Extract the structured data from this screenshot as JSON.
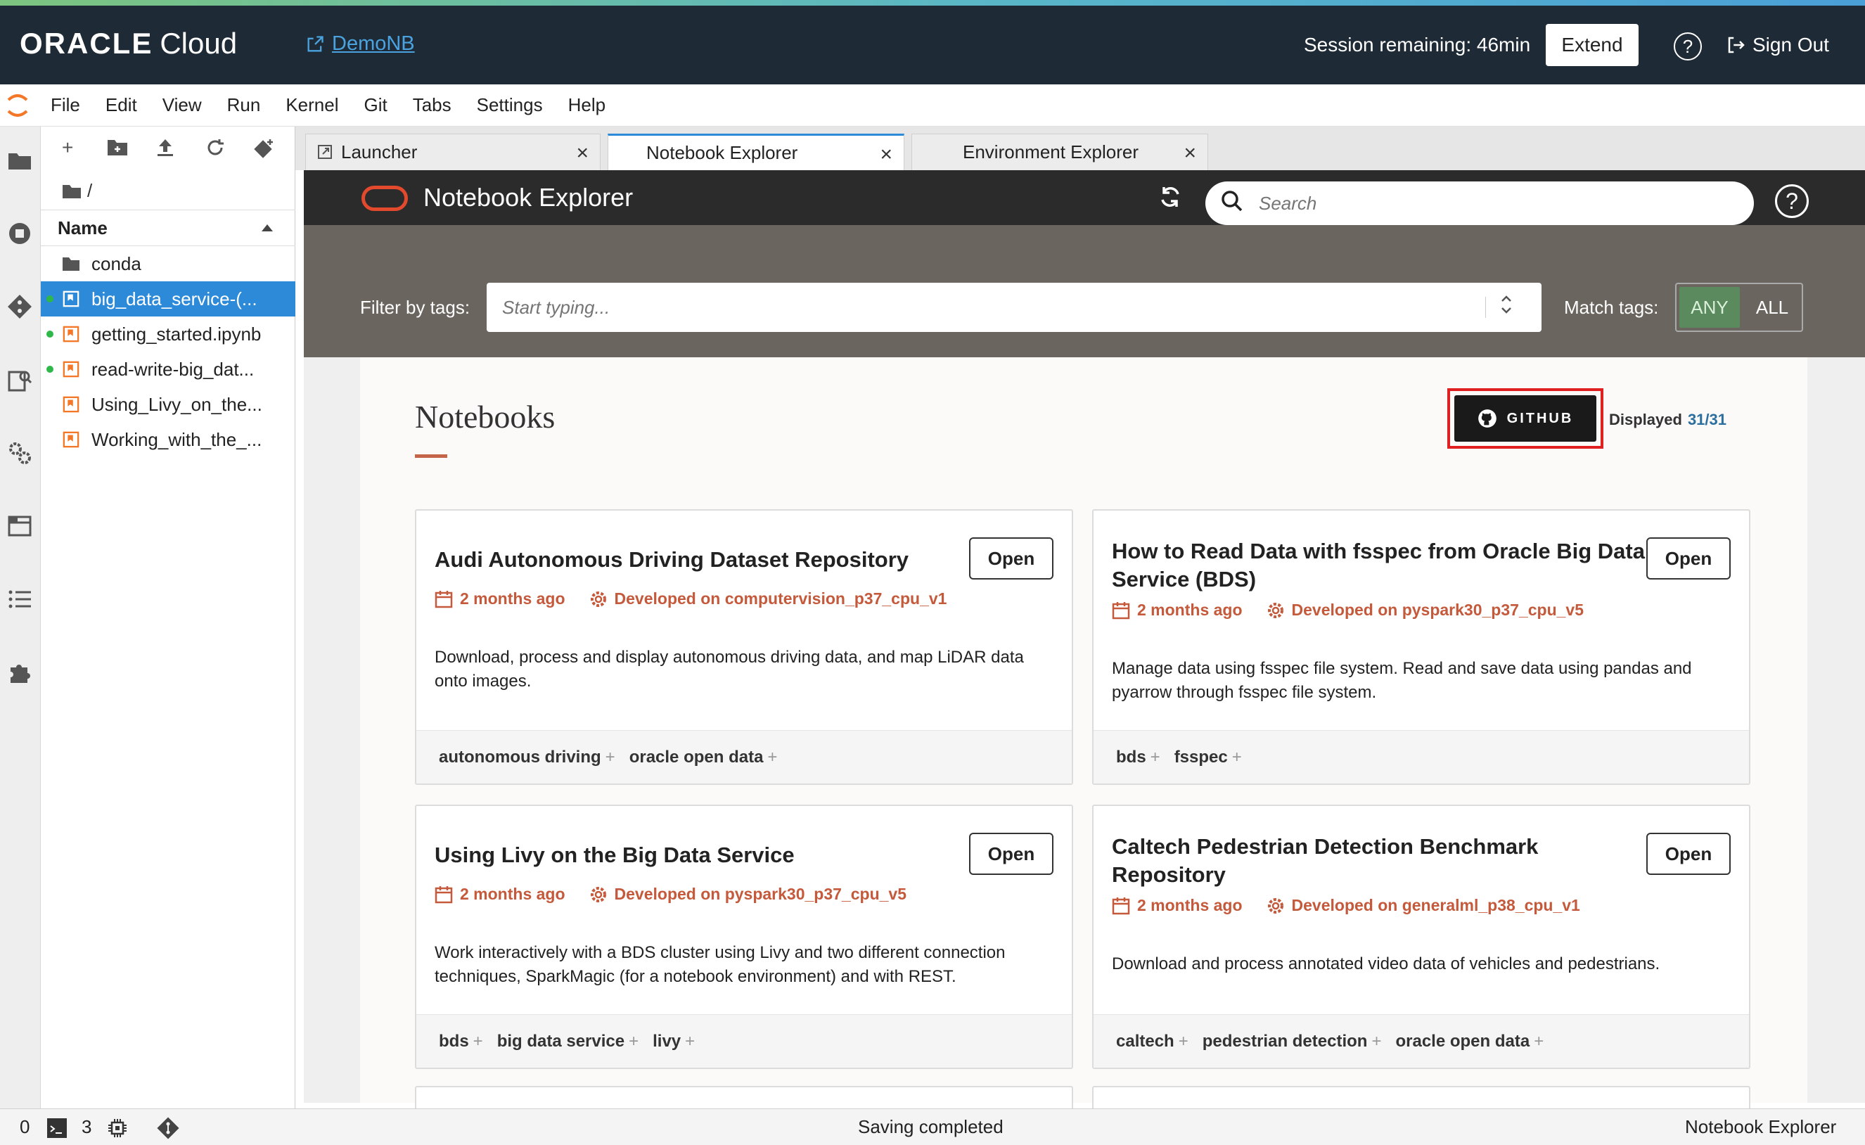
{
  "header": {
    "logo_main": "ORACLE",
    "logo_sub": "Cloud",
    "project_link": "DemoNB",
    "session": "Session remaining: 46min",
    "extend_label": "Extend",
    "help_glyph": "?",
    "signout_label": "Sign Out"
  },
  "menu": [
    "File",
    "Edit",
    "View",
    "Run",
    "Kernel",
    "Git",
    "Tabs",
    "Settings",
    "Help"
  ],
  "file_browser": {
    "path": "/",
    "column_name": "Name",
    "items": [
      {
        "name": "conda",
        "type": "folder",
        "running": false,
        "selected": false
      },
      {
        "name": "big_data_service-(...",
        "type": "notebook",
        "running": true,
        "selected": true
      },
      {
        "name": "getting_started.ipynb",
        "type": "notebook",
        "running": true,
        "selected": false
      },
      {
        "name": "read-write-big_dat...",
        "type": "notebook",
        "running": true,
        "selected": false
      },
      {
        "name": "Using_Livy_on_the...",
        "type": "notebook",
        "running": false,
        "selected": false
      },
      {
        "name": "Working_with_the_...",
        "type": "notebook",
        "running": false,
        "selected": false
      }
    ]
  },
  "tabs": [
    {
      "label": "Launcher",
      "active": false
    },
    {
      "label": "Notebook Explorer",
      "active": true
    },
    {
      "label": "Environment Explorer",
      "active": false
    }
  ],
  "explorer": {
    "title": "Notebook Explorer",
    "search_placeholder": "Search",
    "filter_label": "Filter by tags:",
    "filter_placeholder": "Start typing...",
    "match_label": "Match tags:",
    "match_any": "ANY",
    "match_all": "ALL",
    "section_title": "Notebooks",
    "github_label": "GITHUB",
    "displayed_label": "Displayed",
    "displayed_count": "31/31"
  },
  "cards": [
    {
      "title": "Audi Autonomous Driving Dataset Repository",
      "open": "Open",
      "date": "2 months ago",
      "env": "Developed on computervision_p37_cpu_v1",
      "description": "Download, process and display autonomous driving data, and map LiDAR data onto images.",
      "tags": [
        "autonomous driving",
        "oracle open data"
      ]
    },
    {
      "title": "How to Read Data with fsspec from Oracle Big Data Service (BDS)",
      "open": "Open",
      "date": "2 months ago",
      "env": "Developed on pyspark30_p37_cpu_v5",
      "description": "Manage data using fsspec file system. Read and save data using pandas and pyarrow through fsspec file system.",
      "tags": [
        "bds",
        "fsspec"
      ]
    },
    {
      "title": "Using Livy on the Big Data Service",
      "open": "Open",
      "date": "2 months ago",
      "env": "Developed on pyspark30_p37_cpu_v5",
      "description": "Work interactively with a BDS cluster using Livy and two different connection techniques, SparkMagic (for a notebook environment) and with REST.",
      "tags": [
        "bds",
        "big data service",
        "livy"
      ]
    },
    {
      "title": "Caltech Pedestrian Detection Benchmark Repository",
      "open": "Open",
      "date": "2 months ago",
      "env": "Developed on generalml_p38_cpu_v1",
      "description": "Download and process annotated video data of vehicles and pedestrians.",
      "tags": [
        "caltech",
        "pedestrian detection",
        "oracle open data"
      ]
    }
  ],
  "status": {
    "zero": "0",
    "three": "3",
    "message": "Saving completed",
    "right": "Notebook Explorer"
  },
  "colors": {
    "header_bg": "#1e2a35",
    "accent_blue": "#2c8ad8",
    "oracle_red": "#e3492d",
    "meta_orange": "#c45a3b",
    "match_any_green": "#5b8a5e"
  }
}
